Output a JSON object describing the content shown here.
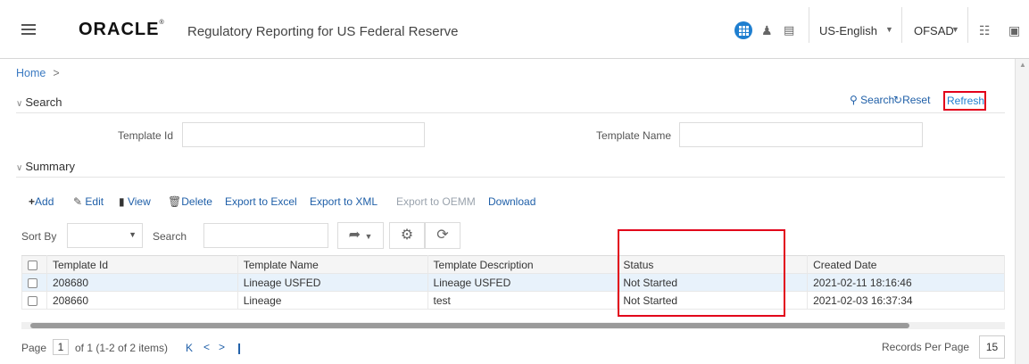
{
  "header": {
    "logo": "ORACLE",
    "logo_mark": "®",
    "app_title": "Regulatory Reporting for US Federal Reserve",
    "language": "US-English",
    "user": "OFSAD",
    "icons": [
      "hamburger-icon",
      "apps-grid-icon",
      "user-admin-icon",
      "document-icon",
      "hierarchy-icon",
      "logout-icon"
    ]
  },
  "breadcrumb": {
    "home": "Home",
    "separator": ">"
  },
  "search_section": {
    "title": "Search",
    "actions": {
      "search": "Search",
      "reset": "Reset",
      "refresh": "Refresh"
    },
    "fields": {
      "template_id_label": "Template Id",
      "template_id_value": "",
      "template_name_label": "Template Name",
      "template_name_value": ""
    }
  },
  "summary_section": {
    "title": "Summary",
    "toolbar": {
      "add": "Add",
      "edit": "Edit",
      "view": "View",
      "delete": "Delete",
      "export_excel": "Export to Excel",
      "export_xml": "Export to XML",
      "export_oemm": "Export to OEMM",
      "download": "Download"
    },
    "sort_by_label": "Sort By",
    "sort_by_value": "",
    "search_label": "Search",
    "search_value": ""
  },
  "table": {
    "columns": [
      "Template Id",
      "Template Name",
      "Template Description",
      "Status",
      "Created Date"
    ],
    "rows": [
      {
        "id": "208680",
        "name": "Lineage USFED",
        "description": "Lineage USFED",
        "status": "Not Started",
        "created": "2021-02-11 18:16:46"
      },
      {
        "id": "208660",
        "name": "Lineage",
        "description": "test",
        "status": "Not Started",
        "created": "2021-02-03 16:37:34"
      }
    ]
  },
  "pager": {
    "page_label": "Page",
    "page_number": "1",
    "page_info": "of 1 (1-2 of 2 items)",
    "records_per_page_label": "Records Per Page",
    "records_per_page": "15"
  },
  "colors": {
    "highlight_red": "#e2001a",
    "link_blue": "#1f5fa8",
    "accent_blue": "#1f7fd0",
    "selected_row": "#e8f2fb"
  }
}
